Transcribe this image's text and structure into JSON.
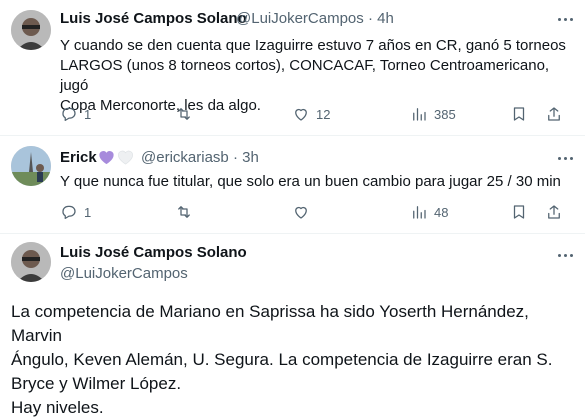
{
  "tweets": [
    {
      "display_name": "Luis José Campos Solano",
      "handle": "@LuiJokerCampos",
      "separator": "·",
      "time": "4h",
      "lines": [
        "Y cuando se den cuenta que Izaguirre estuvo 7 años en CR, ganó 5 torneos",
        "LARGOS (unos 8 torneos cortos), CONCACAF, Torneo Centroamericano, jugó",
        "Copa Merconorte, les da algo."
      ],
      "replies": "1",
      "retweets": "",
      "likes": "12",
      "views": "385"
    },
    {
      "display_name": "Erick",
      "handle": "@erickariasb",
      "separator": "·",
      "time": "3h",
      "lines": [
        "Y que nunca fue titular, que solo era un buen cambio para jugar 25 / 30 min"
      ],
      "replies": "1",
      "retweets": "",
      "likes": "",
      "views": "48"
    }
  ],
  "main_tweet": {
    "display_name": "Luis José Campos Solano",
    "handle": "@LuiJokerCampos",
    "lines": [
      "La competencia de Mariano en Saprissa ha sido Yoserth Hernández, Marvin",
      "Ángulo, Keven Alemán, U. Segura. La competencia de Izaguirre eran S.",
      "Bryce y Wilmer López.",
      "Hay niveles."
    ]
  },
  "colors": {
    "text": "#0f1419",
    "secondary": "#536471",
    "divider": "#eff3f4",
    "purple_heart": "#a78bdc"
  }
}
